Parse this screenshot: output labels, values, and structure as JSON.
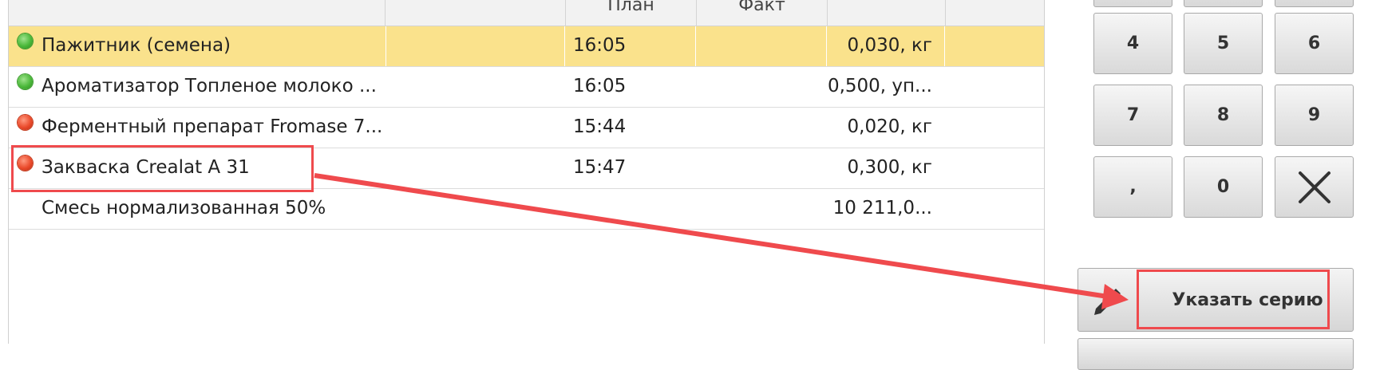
{
  "table": {
    "headers": [
      "",
      "",
      "План",
      "Факт",
      "",
      ""
    ],
    "rows": [
      {
        "status": "green",
        "name": "Пажитник (семена)",
        "time": "16:05",
        "fact": "0,030, кг",
        "selected": true
      },
      {
        "status": "green",
        "name": "Ароматизатор Топленое молоко ...",
        "time": "16:05",
        "fact": "0,500, уп...",
        "selected": false
      },
      {
        "status": "red",
        "name": "Ферментный препарат Fromase 7...",
        "time": "15:44",
        "fact": "0,020, кг",
        "selected": false
      },
      {
        "status": "red",
        "name": "Закваска Crealat A 31",
        "time": "15:47",
        "fact": "0,300, кг",
        "selected": false
      },
      {
        "status": "none",
        "name": "Смесь нормализованная 50%",
        "time": "",
        "fact": "10 211,0...",
        "selected": false
      }
    ]
  },
  "keypad": {
    "keys": [
      "4",
      "5",
      "6",
      "7",
      "8",
      "9",
      ",",
      "0"
    ],
    "clear_icon": "x-icon"
  },
  "actions": {
    "edit_icon": "pencil-icon",
    "set_series_label": "Указать серию"
  },
  "colors": {
    "selected_row": "#fae28c",
    "annotation": "#ef4a4d",
    "status_green": "#4bb83a",
    "status_red": "#ea4a2b"
  }
}
